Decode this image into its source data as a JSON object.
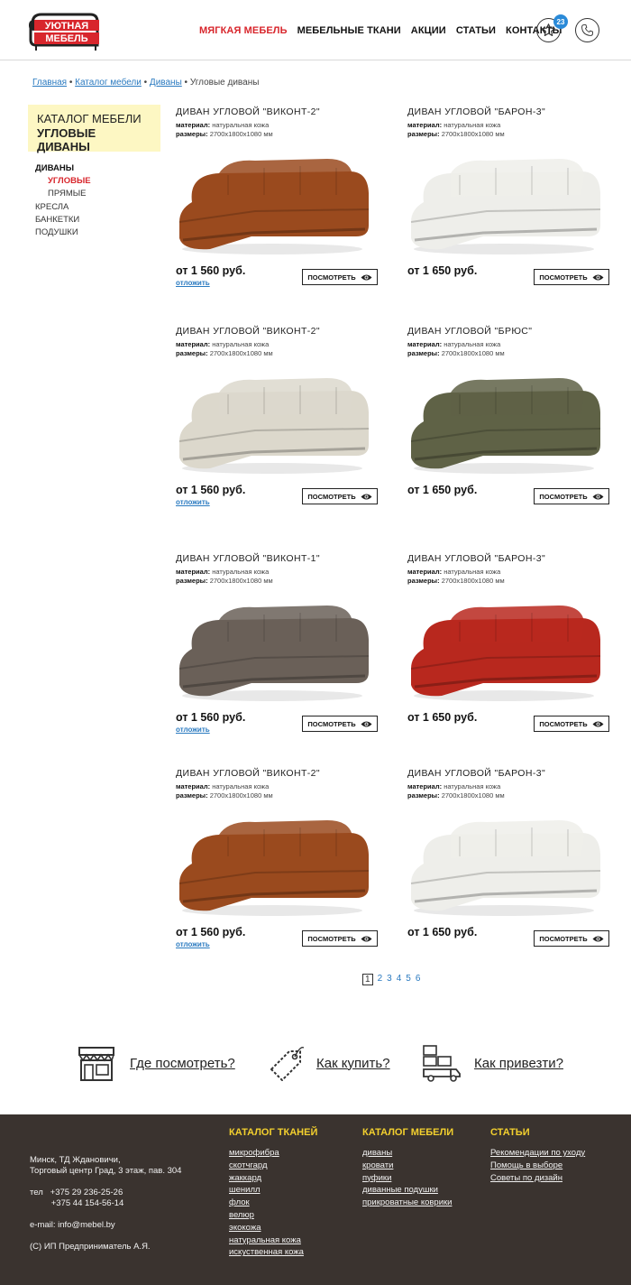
{
  "header": {
    "logo_line1": "УЮТНАЯ",
    "logo_line2": "МЕБЕЛЬ",
    "nav": [
      "Мягкая мебель",
      "Мебельные ткани",
      "Акции",
      "Статьи",
      "Контакты"
    ],
    "favorites_count": "23"
  },
  "breadcrumb": {
    "items": [
      "Главная",
      "Каталог мебели",
      "Диваны"
    ],
    "current": "Угловые диваны"
  },
  "sidebar": {
    "box_line1": "КАТАЛОГ МЕБЕЛИ",
    "box_line2": "УГЛОВЫЕ ДИВАНЫ",
    "menu": [
      "ДИВАНЫ",
      "УГЛОВЫЕ",
      "ПРЯМЫЕ",
      "КРЕСЛА",
      "БАНКЕТКИ",
      "ПОДУШКИ"
    ]
  },
  "product_labels": {
    "material_label": "материал:",
    "size_label": "размеры:",
    "view_button": "ПОСМОТРЕТЬ",
    "later_link": "отложить"
  },
  "products": [
    {
      "title": "ДИВАН УГЛОВОЙ \"ВИКОНТ-2\"",
      "material": "натуральная кожа",
      "size": "2700х1800х1080 мм",
      "price": "от 1 560 руб.",
      "color": "#9a4a1e",
      "later": true
    },
    {
      "title": "ДИВАН УГЛОВОЙ \"БАРОН-3\"",
      "material": "натуральная кожа",
      "size": "2700х1800х1080 мм",
      "price": "от 1 650 руб.",
      "color": "#eeeeea",
      "later": false
    },
    {
      "title": "ДИВАН УГЛОВОЙ \"ВИКОНТ-2\"",
      "material": "натуральная кожа",
      "size": "2700х1800х1080 мм",
      "price": "от 1 560 руб.",
      "color": "#dcd8cc",
      "later": true
    },
    {
      "title": "ДИВАН УГЛОВОЙ \"БРЮС\"",
      "material": "натуральная кожа",
      "size": "2700х1800х1080 мм",
      "price": "от 1 650 руб.",
      "color": "#5f6246",
      "later": false
    },
    {
      "title": "ДИВАН УГЛОВОЙ \"ВИКОНТ-1\"",
      "material": "натуральная кожа",
      "size": "2700х1800х1080 мм",
      "price": "от 1 560 руб.",
      "color": "#6a6058",
      "later": true
    },
    {
      "title": "ДИВАН УГЛОВОЙ \"БАРОН-3\"",
      "material": "натуральная кожа",
      "size": "2700х1800х1080 мм",
      "price": "от 1 650 руб.",
      "color": "#b8281e",
      "later": false
    },
    {
      "title": "ДИВАН УГЛОВОЙ \"ВИКОНТ-2\"",
      "material": "натуральная кожа",
      "size": "2700х1800х1080 мм",
      "price": "от 1 560 руб.",
      "color": "#9a4a1e",
      "later": true
    },
    {
      "title": "ДИВАН УГЛОВОЙ \"БАРОН-3\"",
      "material": "натуральная кожа",
      "size": "2700х1800х1080 мм",
      "price": "от 1 650 руб.",
      "color": "#eeeeea",
      "later": false
    }
  ],
  "pagination": [
    "1",
    "2",
    "3",
    "4",
    "5",
    "6"
  ],
  "info": {
    "where": "Где посмотреть?",
    "how_buy": "Как купить?",
    "delivery": "Как привезти?"
  },
  "footer": {
    "contacts": [
      "Минск, ТД Ждановичи,",
      "Торговый центр Град, 3 этаж, пав. 304",
      "",
      "тел   +375 29 236-25-26",
      "         +375 44 154-56-14",
      "",
      "e-mail: info@mebel.by",
      "",
      "(С) ИП Предприниматель А.Я."
    ],
    "fabrics_title": "КАТАЛОГ ТКАНЕЙ",
    "fabrics": [
      "микрофибра",
      "скотчгард",
      "жаккард",
      "шенилл",
      "флок",
      "велюр",
      "экокожа",
      "натуральная кожа",
      "искуственная кожа"
    ],
    "catalog_title": "КАТАЛОГ МЕБЕЛИ",
    "catalog": [
      "диваны",
      "кровати",
      "пуфики",
      "диванные подушки",
      "прикроватные коврики"
    ],
    "articles_title": "СТАТЬИ",
    "articles": [
      "Рекомендации по уходу",
      "Помощь в выборе",
      "Советы по дизайн"
    ]
  },
  "colors": {
    "accent_red": "#d8262c",
    "link_blue": "#2a7ac0",
    "badge_blue": "#2a8ad8",
    "footer_bg": "#3a332f",
    "footer_heading": "#f3d02e",
    "category_box": "#fdf7c3"
  }
}
